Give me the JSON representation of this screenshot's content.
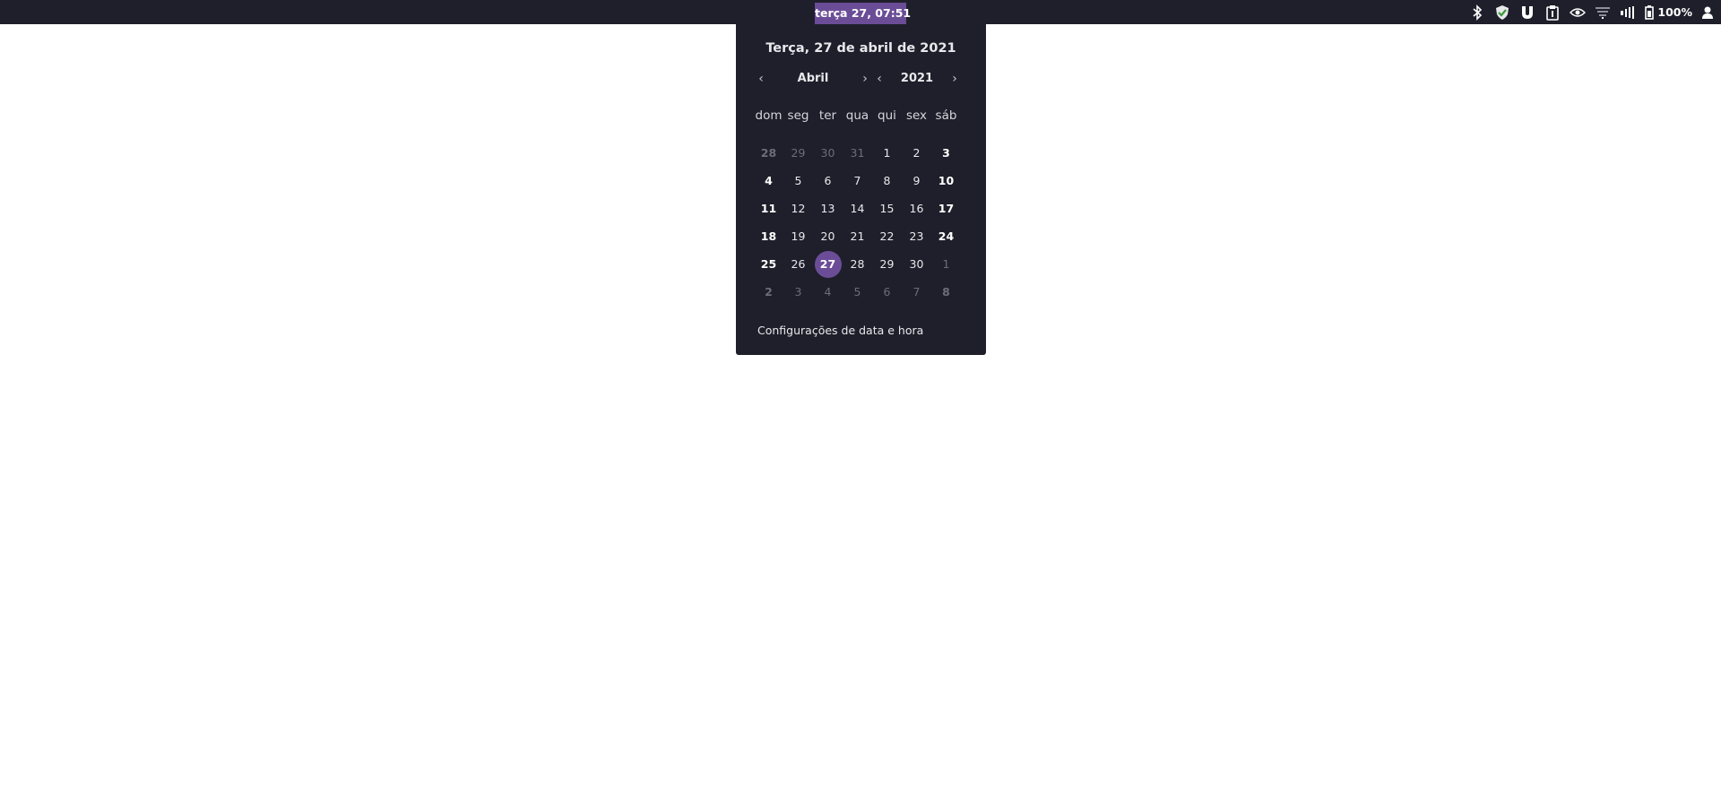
{
  "topbar": {
    "clock_label": "terça 27, 07:51",
    "battery_percent": "100%",
    "tray_icons": [
      "bluetooth-icon",
      "shield-check-icon",
      "magnet-icon",
      "clipboard-icon",
      "nvidia-icon",
      "wifi-icon",
      "volume-icon",
      "battery-icon",
      "user-icon"
    ]
  },
  "calendar": {
    "full_date": "Terça, 27 de abril de 2021",
    "month_label": "Abril",
    "year_label": "2021",
    "prev_arrow": "‹",
    "next_arrow": "›",
    "weekdays": [
      "dom",
      "seg",
      "ter",
      "qua",
      "qui",
      "sex",
      "sáb"
    ],
    "weeks": [
      [
        {
          "d": "28",
          "other": true,
          "bold": true
        },
        {
          "d": "29",
          "other": true
        },
        {
          "d": "30",
          "other": true
        },
        {
          "d": "31",
          "other": true
        },
        {
          "d": "1"
        },
        {
          "d": "2"
        },
        {
          "d": "3",
          "bold": true
        }
      ],
      [
        {
          "d": "4",
          "bold": true
        },
        {
          "d": "5"
        },
        {
          "d": "6"
        },
        {
          "d": "7"
        },
        {
          "d": "8"
        },
        {
          "d": "9"
        },
        {
          "d": "10",
          "bold": true
        }
      ],
      [
        {
          "d": "11",
          "bold": true
        },
        {
          "d": "12"
        },
        {
          "d": "13"
        },
        {
          "d": "14"
        },
        {
          "d": "15"
        },
        {
          "d": "16"
        },
        {
          "d": "17",
          "bold": true
        }
      ],
      [
        {
          "d": "18",
          "bold": true
        },
        {
          "d": "19"
        },
        {
          "d": "20"
        },
        {
          "d": "21"
        },
        {
          "d": "22"
        },
        {
          "d": "23"
        },
        {
          "d": "24",
          "bold": true
        }
      ],
      [
        {
          "d": "25",
          "bold": true
        },
        {
          "d": "26"
        },
        {
          "d": "27",
          "today": true
        },
        {
          "d": "28"
        },
        {
          "d": "29"
        },
        {
          "d": "30"
        },
        {
          "d": "1",
          "other": true
        }
      ],
      [
        {
          "d": "2",
          "other": true,
          "bold": true
        },
        {
          "d": "3",
          "other": true
        },
        {
          "d": "4",
          "other": true
        },
        {
          "d": "5",
          "other": true
        },
        {
          "d": "6",
          "other": true
        },
        {
          "d": "7",
          "other": true
        },
        {
          "d": "8",
          "other": true,
          "bold": true
        }
      ]
    ],
    "settings_link": "Configurações de data e hora"
  },
  "colors": {
    "panel_bg": "#1f1f2b",
    "accent": "#6b4d97",
    "desktop_bg": "#ffffff"
  }
}
